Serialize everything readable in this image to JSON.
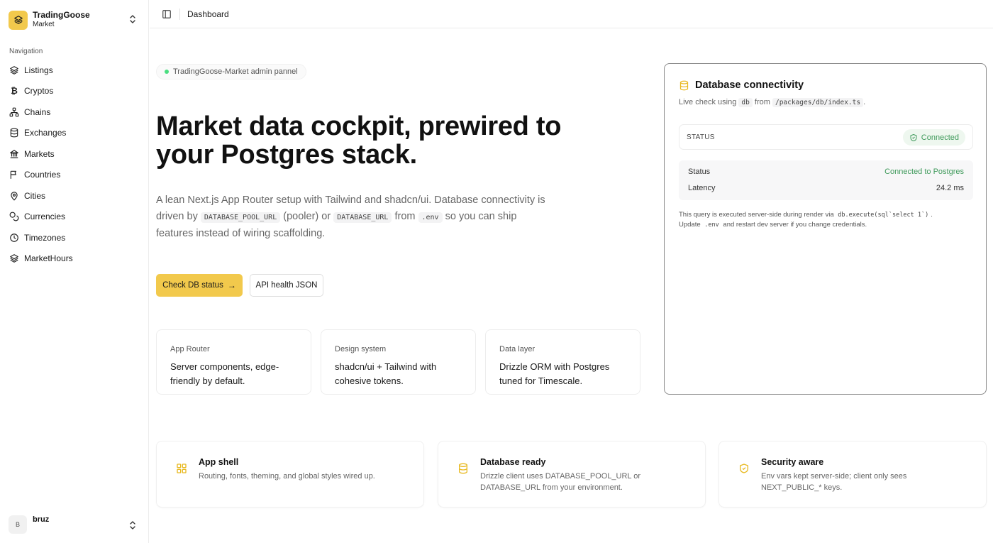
{
  "org": {
    "name": "TradingGoose",
    "subtitle": "Market"
  },
  "sidebar": {
    "section_title": "Navigation",
    "items": [
      {
        "label": "Listings",
        "icon": "layers-icon"
      },
      {
        "label": "Cryptos",
        "icon": "bitcoin-icon"
      },
      {
        "label": "Chains",
        "icon": "network-icon"
      },
      {
        "label": "Exchanges",
        "icon": "database-icon"
      },
      {
        "label": "Markets",
        "icon": "landmark-icon"
      },
      {
        "label": "Countries",
        "icon": "flag-icon"
      },
      {
        "label": "Cities",
        "icon": "map-pin-icon"
      },
      {
        "label": "Currencies",
        "icon": "coins-icon"
      },
      {
        "label": "Timezones",
        "icon": "clock-icon"
      },
      {
        "label": "MarketHours",
        "icon": "layers-icon"
      }
    ]
  },
  "user": {
    "initial": "B",
    "name": "bruz"
  },
  "topbar": {
    "breadcrumb": "Dashboard"
  },
  "hero": {
    "pill": "TradingGoose-Market admin pannel",
    "title": "Market data cockpit, prewired to your Postgres stack.",
    "desc_1": "A lean Next.js App Router setup with Tailwind and shadcn/ui. Database connectivity is driven by ",
    "code_1": "DATABASE_POOL_URL",
    "desc_2": " (pooler) or ",
    "code_2": "DATABASE_URL",
    "desc_3": " from ",
    "code_3": ".env",
    "desc_4": " so you can ship features instead of wiring scaffolding.",
    "primary_button": "Check DB status",
    "secondary_button": "API health JSON"
  },
  "features": [
    {
      "label": "App Router",
      "text": "Server components, edge-friendly by default."
    },
    {
      "label": "Design system",
      "text": "shadcn/ui + Tailwind with cohesive tokens."
    },
    {
      "label": "Data layer",
      "text": "Drizzle ORM with Postgres tuned for Timescale."
    }
  ],
  "db_card": {
    "title": "Database connectivity",
    "sub_1": "Live check using ",
    "sub_code_1": "db",
    "sub_2": " from ",
    "sub_code_2": "/packages/db/index.ts",
    "sub_3": ".",
    "status_key": "STATUS",
    "status_badge": "Connected",
    "rows": [
      {
        "key": "Status",
        "value": "Connected to Postgres"
      },
      {
        "key": "Latency",
        "value": "24.2 ms"
      }
    ],
    "note_1": "This query is executed server-side during render via ",
    "note_code_1": "db.execute(sql`select 1`)",
    "note_2": ".",
    "note_3": "Update ",
    "note_code_2": ".env",
    "note_4": " and restart dev server if you change credentials."
  },
  "bottom_cards": [
    {
      "title": "App shell",
      "desc": "Routing, fonts, theming, and global styles wired up.",
      "icon": "grid-icon"
    },
    {
      "title": "Database ready",
      "desc": "Drizzle client uses DATABASE_POOL_URL or DATABASE_URL from your environment.",
      "icon": "database-icon"
    },
    {
      "title": "Security aware",
      "desc": "Env vars kept server-side; client only sees NEXT_PUBLIC_* keys.",
      "icon": "shield-check-icon"
    }
  ],
  "colors": {
    "accent": "#f2c94c",
    "success": "#3f9a5b",
    "status_dot": "#4ade80"
  }
}
